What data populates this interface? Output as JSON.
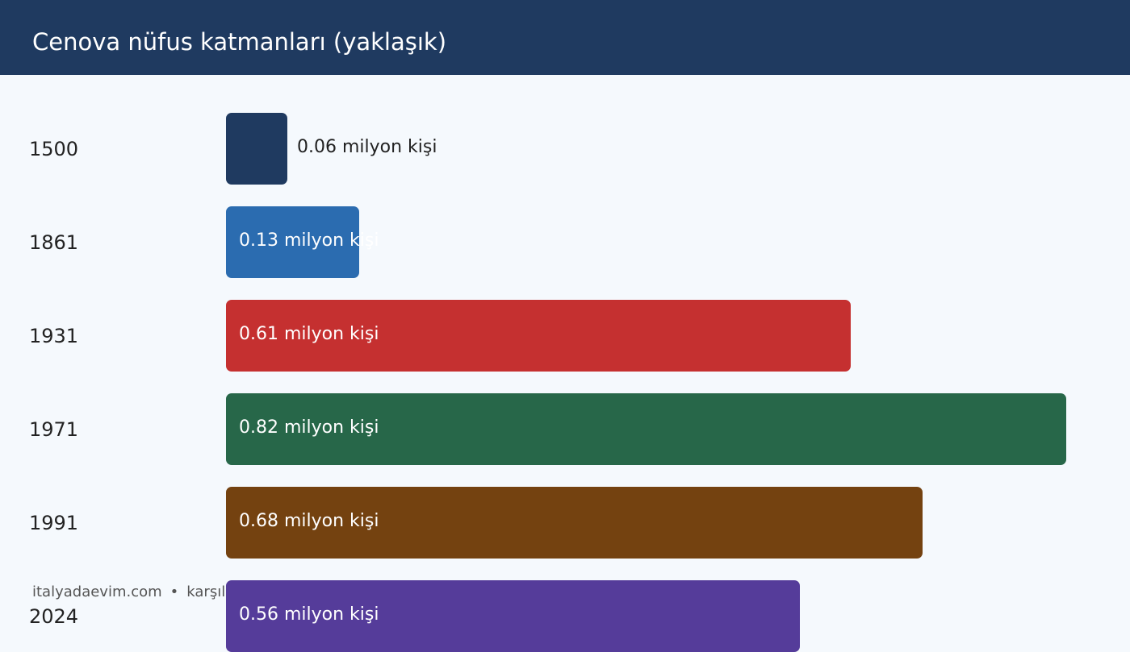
{
  "header": {
    "title": "Cenova nüfus katmanları (yaklaşık)"
  },
  "footer": {
    "site": "italyadaevim.com",
    "separator": "•",
    "note": "karşılaş"
  },
  "colors": {
    "header_bg": "#1f3a60",
    "page_bg": "#f5f9fd"
  },
  "chart_data": {
    "type": "bar",
    "orientation": "horizontal",
    "title": "Cenova nüfus katmanları (yaklaşık)",
    "categories": [
      "1500",
      "1861",
      "1931",
      "1971",
      "1991",
      "2024"
    ],
    "values": [
      0.06,
      0.13,
      0.61,
      0.82,
      0.68,
      0.56
    ],
    "value_labels": [
      "0.06 milyon kişi",
      "0.13 milyon kişi",
      "0.61 milyon kişi",
      "0.82 milyon kişi",
      "0.68 milyon kişi",
      "0.56 milyon kişi"
    ],
    "unit": "milyon kişi",
    "bar_colors": [
      "#1f3a60",
      "#2b6cb0",
      "#c53030",
      "#276749",
      "#744210",
      "#553c9a"
    ],
    "xlim": [
      0,
      0.82
    ],
    "grid": false,
    "legend": "none"
  }
}
